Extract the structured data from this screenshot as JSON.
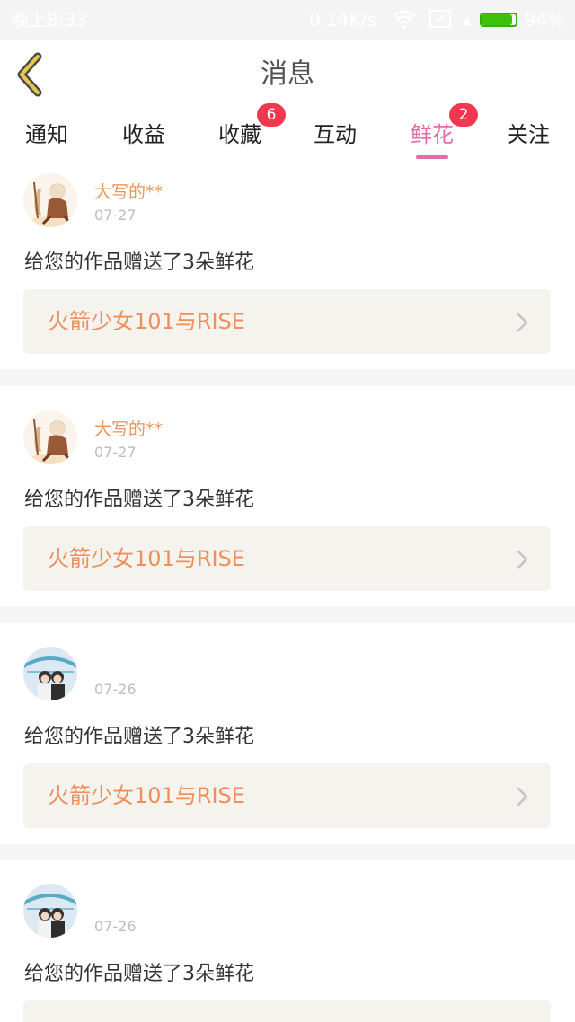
{
  "status_bar": {
    "time": "晚上8:33",
    "net_speed": "0.14K/s",
    "battery_percent": "94%",
    "battery_level": 0.94,
    "icons": [
      "wifi-icon",
      "sim-card-icon",
      "signal-icon",
      "battery-icon"
    ]
  },
  "header": {
    "title": "消息",
    "back_icon": "chevron-left-icon",
    "accent_color": "#e8c84a"
  },
  "tabs": [
    {
      "label": "通知",
      "badge": null,
      "active": false
    },
    {
      "label": "收益",
      "badge": null,
      "active": false
    },
    {
      "label": "收藏",
      "badge": "6",
      "active": false
    },
    {
      "label": "互动",
      "badge": null,
      "active": false
    },
    {
      "label": "鲜花",
      "badge": "2",
      "active": true
    },
    {
      "label": "关注",
      "badge": null,
      "active": false
    }
  ],
  "colors": {
    "active_tab": "#e46aa8",
    "badge": "#f2384e",
    "username": "#e8965e",
    "work_title": "#ef8f5c"
  },
  "messages": [
    {
      "username": "大写的**",
      "date": "07-27",
      "text": "给您的作品赠送了3朵鲜花",
      "work_title": "火箭少女101与RISE",
      "avatar": "anime-character-avatar"
    },
    {
      "username": "大写的**",
      "date": "07-27",
      "text": "给您的作品赠送了3朵鲜花",
      "work_title": "火箭少女101与RISE",
      "avatar": "anime-character-avatar"
    },
    {
      "username": "",
      "date": "07-26",
      "text": "给您的作品赠送了3朵鲜花",
      "work_title": "火箭少女101与RISE",
      "avatar": "photo-avatar"
    },
    {
      "username": "",
      "date": "07-26",
      "text": "给您的作品赠送了3朵鲜花",
      "work_title": "",
      "avatar": "photo-avatar"
    }
  ]
}
